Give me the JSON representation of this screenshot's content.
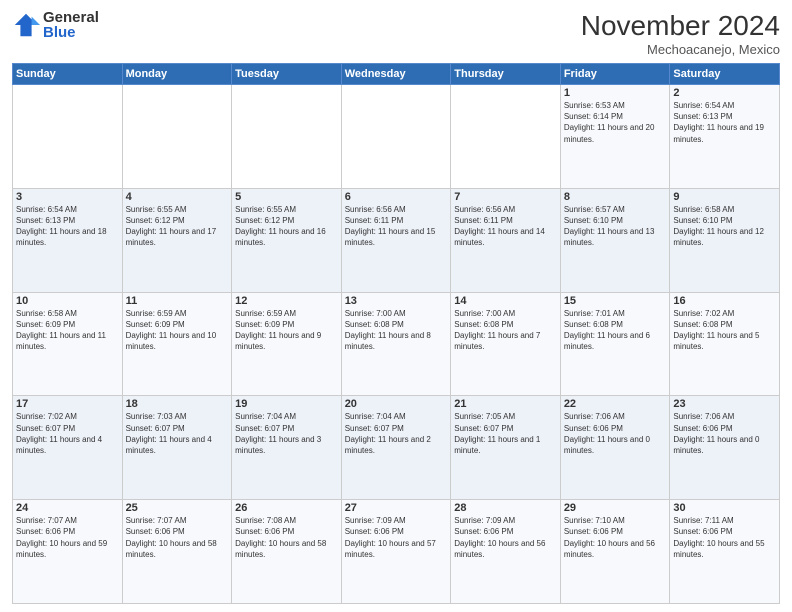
{
  "header": {
    "logo_general": "General",
    "logo_blue": "Blue",
    "month_year": "November 2024",
    "location": "Mechoacanejo, Mexico"
  },
  "weekdays": [
    "Sunday",
    "Monday",
    "Tuesday",
    "Wednesday",
    "Thursday",
    "Friday",
    "Saturday"
  ],
  "weeks": [
    [
      {
        "day": "",
        "info": ""
      },
      {
        "day": "",
        "info": ""
      },
      {
        "day": "",
        "info": ""
      },
      {
        "day": "",
        "info": ""
      },
      {
        "day": "",
        "info": ""
      },
      {
        "day": "1",
        "info": "Sunrise: 6:53 AM\nSunset: 6:14 PM\nDaylight: 11 hours and 20 minutes."
      },
      {
        "day": "2",
        "info": "Sunrise: 6:54 AM\nSunset: 6:13 PM\nDaylight: 11 hours and 19 minutes."
      }
    ],
    [
      {
        "day": "3",
        "info": "Sunrise: 6:54 AM\nSunset: 6:13 PM\nDaylight: 11 hours and 18 minutes."
      },
      {
        "day": "4",
        "info": "Sunrise: 6:55 AM\nSunset: 6:12 PM\nDaylight: 11 hours and 17 minutes."
      },
      {
        "day": "5",
        "info": "Sunrise: 6:55 AM\nSunset: 6:12 PM\nDaylight: 11 hours and 16 minutes."
      },
      {
        "day": "6",
        "info": "Sunrise: 6:56 AM\nSunset: 6:11 PM\nDaylight: 11 hours and 15 minutes."
      },
      {
        "day": "7",
        "info": "Sunrise: 6:56 AM\nSunset: 6:11 PM\nDaylight: 11 hours and 14 minutes."
      },
      {
        "day": "8",
        "info": "Sunrise: 6:57 AM\nSunset: 6:10 PM\nDaylight: 11 hours and 13 minutes."
      },
      {
        "day": "9",
        "info": "Sunrise: 6:58 AM\nSunset: 6:10 PM\nDaylight: 11 hours and 12 minutes."
      }
    ],
    [
      {
        "day": "10",
        "info": "Sunrise: 6:58 AM\nSunset: 6:09 PM\nDaylight: 11 hours and 11 minutes."
      },
      {
        "day": "11",
        "info": "Sunrise: 6:59 AM\nSunset: 6:09 PM\nDaylight: 11 hours and 10 minutes."
      },
      {
        "day": "12",
        "info": "Sunrise: 6:59 AM\nSunset: 6:09 PM\nDaylight: 11 hours and 9 minutes."
      },
      {
        "day": "13",
        "info": "Sunrise: 7:00 AM\nSunset: 6:08 PM\nDaylight: 11 hours and 8 minutes."
      },
      {
        "day": "14",
        "info": "Sunrise: 7:00 AM\nSunset: 6:08 PM\nDaylight: 11 hours and 7 minutes."
      },
      {
        "day": "15",
        "info": "Sunrise: 7:01 AM\nSunset: 6:08 PM\nDaylight: 11 hours and 6 minutes."
      },
      {
        "day": "16",
        "info": "Sunrise: 7:02 AM\nSunset: 6:08 PM\nDaylight: 11 hours and 5 minutes."
      }
    ],
    [
      {
        "day": "17",
        "info": "Sunrise: 7:02 AM\nSunset: 6:07 PM\nDaylight: 11 hours and 4 minutes."
      },
      {
        "day": "18",
        "info": "Sunrise: 7:03 AM\nSunset: 6:07 PM\nDaylight: 11 hours and 4 minutes."
      },
      {
        "day": "19",
        "info": "Sunrise: 7:04 AM\nSunset: 6:07 PM\nDaylight: 11 hours and 3 minutes."
      },
      {
        "day": "20",
        "info": "Sunrise: 7:04 AM\nSunset: 6:07 PM\nDaylight: 11 hours and 2 minutes."
      },
      {
        "day": "21",
        "info": "Sunrise: 7:05 AM\nSunset: 6:07 PM\nDaylight: 11 hours and 1 minute."
      },
      {
        "day": "22",
        "info": "Sunrise: 7:06 AM\nSunset: 6:06 PM\nDaylight: 11 hours and 0 minutes."
      },
      {
        "day": "23",
        "info": "Sunrise: 7:06 AM\nSunset: 6:06 PM\nDaylight: 11 hours and 0 minutes."
      }
    ],
    [
      {
        "day": "24",
        "info": "Sunrise: 7:07 AM\nSunset: 6:06 PM\nDaylight: 10 hours and 59 minutes."
      },
      {
        "day": "25",
        "info": "Sunrise: 7:07 AM\nSunset: 6:06 PM\nDaylight: 10 hours and 58 minutes."
      },
      {
        "day": "26",
        "info": "Sunrise: 7:08 AM\nSunset: 6:06 PM\nDaylight: 10 hours and 58 minutes."
      },
      {
        "day": "27",
        "info": "Sunrise: 7:09 AM\nSunset: 6:06 PM\nDaylight: 10 hours and 57 minutes."
      },
      {
        "day": "28",
        "info": "Sunrise: 7:09 AM\nSunset: 6:06 PM\nDaylight: 10 hours and 56 minutes."
      },
      {
        "day": "29",
        "info": "Sunrise: 7:10 AM\nSunset: 6:06 PM\nDaylight: 10 hours and 56 minutes."
      },
      {
        "day": "30",
        "info": "Sunrise: 7:11 AM\nSunset: 6:06 PM\nDaylight: 10 hours and 55 minutes."
      }
    ]
  ]
}
